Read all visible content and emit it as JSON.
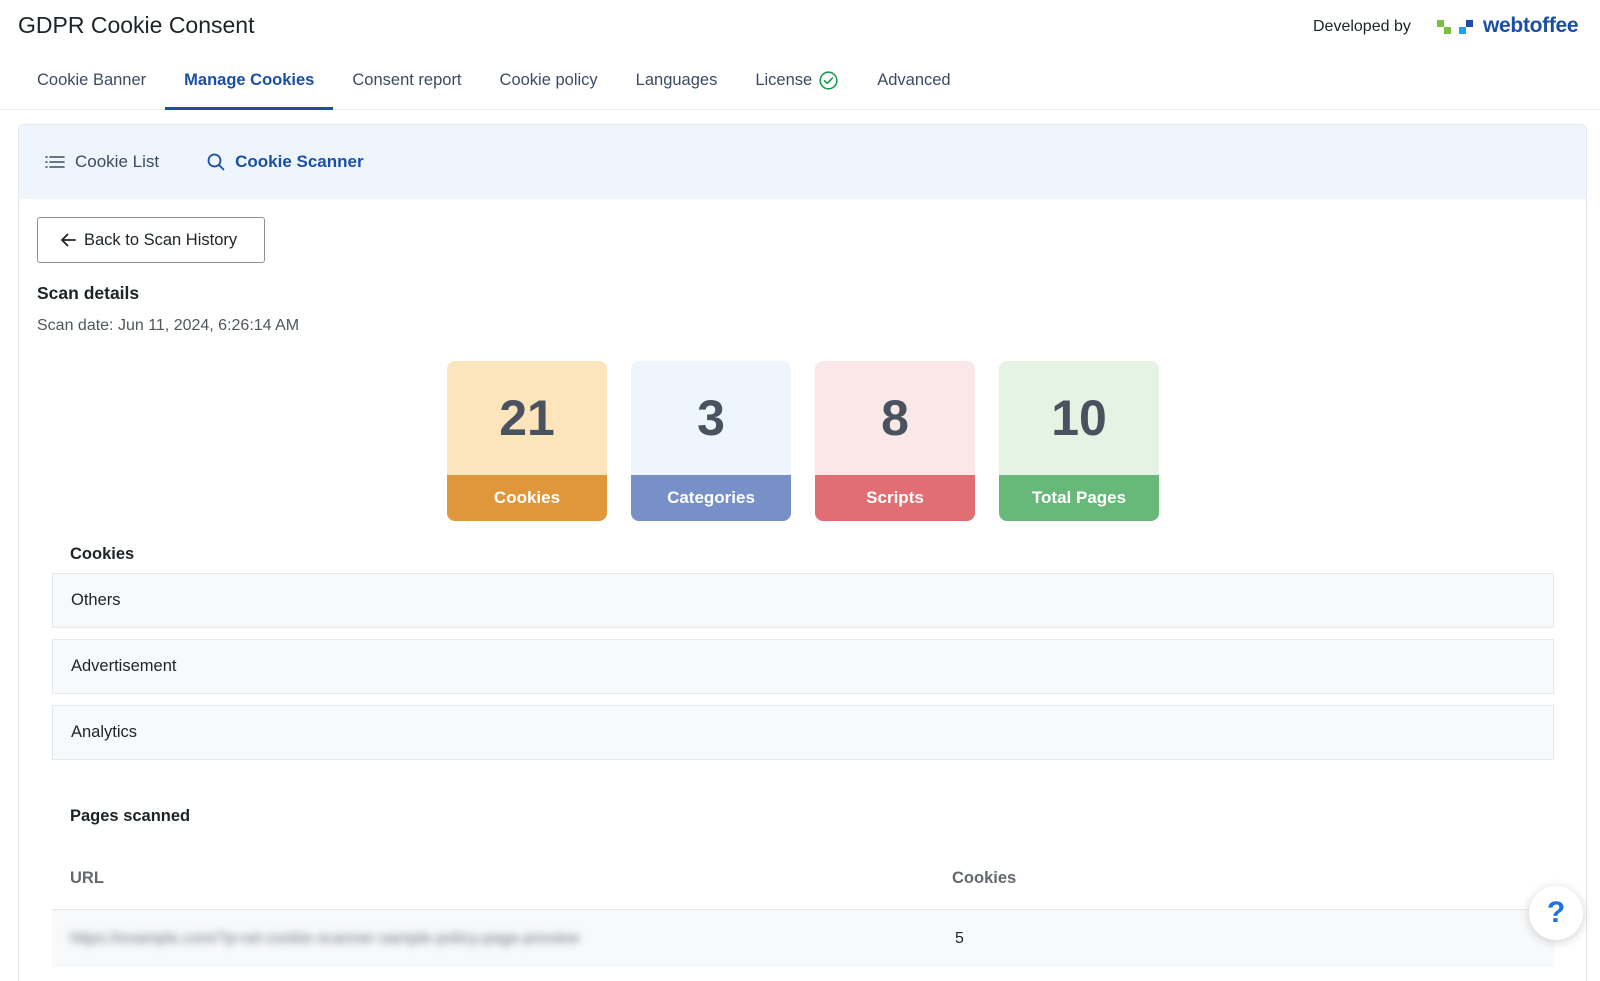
{
  "header": {
    "title": "GDPR Cookie Consent",
    "developed_by": "Developed by",
    "brand_name": "webtoffee",
    "brand_colors": [
      "#7ac143",
      "#1da1f2",
      "#1b4fa3"
    ],
    "tabs": [
      {
        "label": "Cookie Banner",
        "active": false
      },
      {
        "label": "Manage Cookies",
        "active": true
      },
      {
        "label": "Consent report",
        "active": false
      },
      {
        "label": "Cookie policy",
        "active": false
      },
      {
        "label": "Languages",
        "active": false
      },
      {
        "label": "License",
        "active": false,
        "icon": "check-circle-icon",
        "icon_color": "#1a9b4b"
      },
      {
        "label": "Advanced",
        "active": false
      }
    ]
  },
  "subnav": {
    "items": [
      {
        "label": "Cookie List",
        "icon": "list-icon",
        "active": false
      },
      {
        "label": "Cookie Scanner",
        "icon": "search-icon",
        "active": true
      }
    ]
  },
  "back_button": {
    "label": "Back to Scan History",
    "icon": "arrow-left-icon"
  },
  "scan": {
    "title": "Scan details",
    "date": "Scan date: Jun 11, 2024, 6:26:14 AM"
  },
  "stats": [
    {
      "value": "21",
      "label": "Cookies",
      "bg": "#fde5bb",
      "label_bg": "#e0963a"
    },
    {
      "value": "3",
      "label": "Categories",
      "bg": "#eef5fc",
      "label_bg": "#7890c8"
    },
    {
      "value": "8",
      "label": "Scripts",
      "bg": "#fae8e8",
      "label_bg": "#e16e72"
    },
    {
      "value": "10",
      "label": "Total Pages",
      "bg": "#e4f3e4",
      "label_bg": "#68b87a"
    }
  ],
  "cookies_section": {
    "title": "Cookies",
    "categories": [
      "Others",
      "Advertisement",
      "Analytics"
    ]
  },
  "pages_section": {
    "title": "Pages scanned",
    "columns": {
      "url": "URL",
      "cookies": "Cookies"
    },
    "rows": [
      {
        "url": "https://example.com/?p=wt-cookie-scanner-sample-policy-page-preview",
        "cookies": "5"
      }
    ]
  },
  "help": {
    "label": "?"
  }
}
